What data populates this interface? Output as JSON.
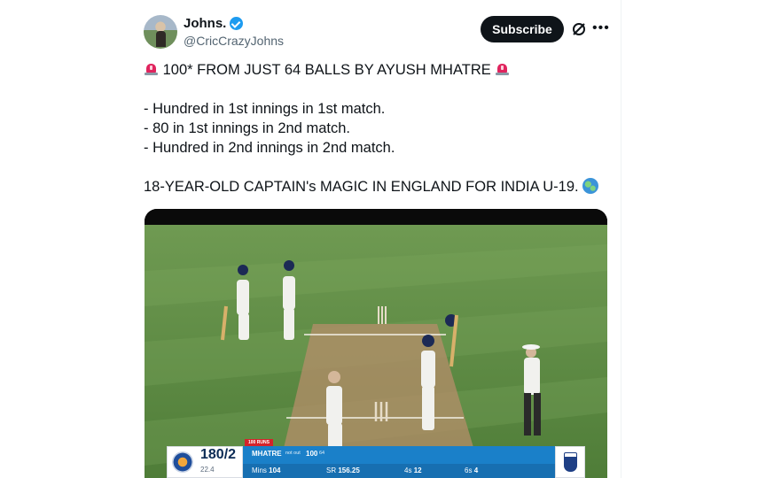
{
  "author": {
    "display_name": "Johns.",
    "handle": "@CricCrazyJohns",
    "verified": true
  },
  "actions": {
    "subscribe_label": "Subscribe",
    "grok_icon": "grok-icon",
    "more_icon": "more-icon"
  },
  "tweet": {
    "headline": "100* FROM JUST 64 BALLS BY AYUSH MHATRE",
    "bullets": [
      "- Hundred in 1st innings in 1st match.",
      "- 80 in 1st innings in 2nd match.",
      "- Hundred in 2nd innings in 2nd match."
    ],
    "closing": "18-YEAR-OLD CAPTAIN's MAGIC IN ENGLAND FOR INDIA U-19.",
    "emoji_headline": "police-car-light",
    "emoji_closing": "globe"
  },
  "scoreboard": {
    "team_score": "180/2",
    "overs": "22.4",
    "tag": "100 RUNS",
    "batter": "MHATRE",
    "status": "not out",
    "runs": "100",
    "balls": "64",
    "mins_label": "Mins",
    "mins": "104",
    "sr_label": "SR",
    "sr": "156.25",
    "fours_label": "4s",
    "fours": "12",
    "sixes_label": "6s",
    "sixes": "4"
  },
  "colors": {
    "accent": "#1d9bf0",
    "button_bg": "#0f1419",
    "muted_text": "#536471",
    "scoreboard_blue": "#1a80c9",
    "pitch_green": "#5f8f45"
  }
}
